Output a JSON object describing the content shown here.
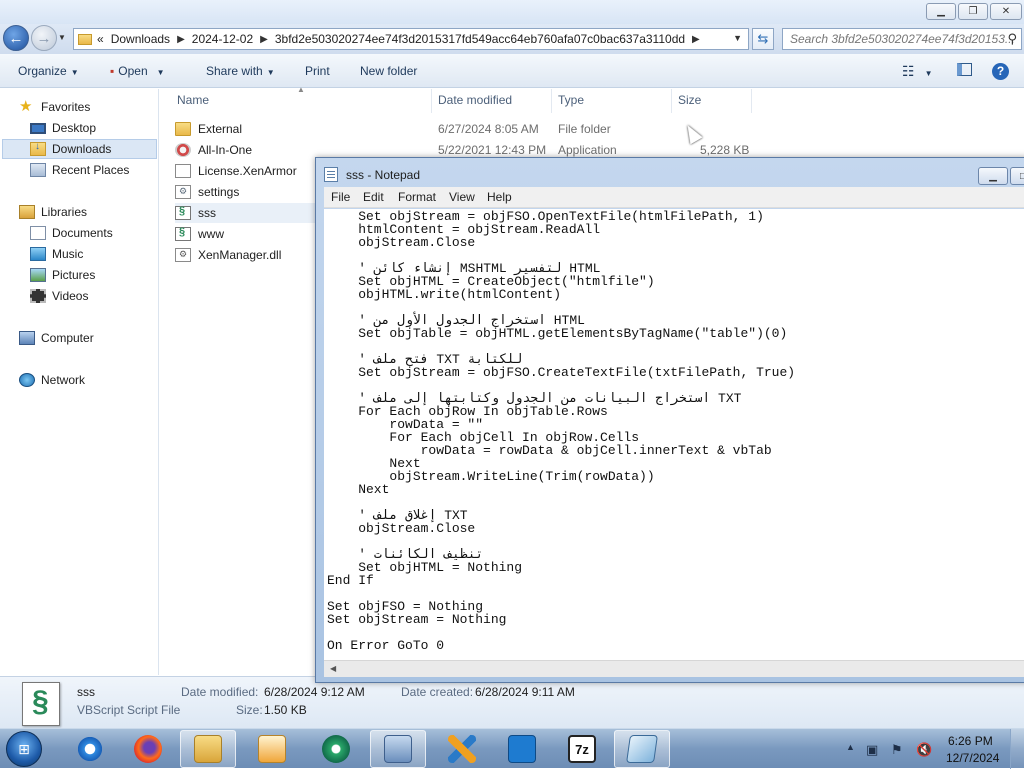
{
  "address_bar": {
    "overflow_marker": "«",
    "crumbs": [
      "Downloads",
      "2024-12-02",
      "3bfd2e503020274ee74f3d2015317fd549acc64eb760afa07c0bac637a3110dd"
    ],
    "search_placeholder": "Search 3bfd2e503020274ee74f3d20153..."
  },
  "toolbar": {
    "organize": "Organize",
    "open": "Open",
    "share_with": "Share with",
    "print": "Print",
    "new_folder": "New folder"
  },
  "nav": {
    "favorites": "Favorites",
    "desktop": "Desktop",
    "downloads": "Downloads",
    "recent_places": "Recent Places",
    "libraries": "Libraries",
    "documents": "Documents",
    "music": "Music",
    "pictures": "Pictures",
    "videos": "Videos",
    "computer": "Computer",
    "network": "Network"
  },
  "columns": {
    "name": "Name",
    "date_modified": "Date modified",
    "type": "Type",
    "size": "Size"
  },
  "files": [
    {
      "name": "External",
      "date": "6/27/2024 8:05 AM",
      "type": "File folder",
      "size": "",
      "icon": "folder-icon"
    },
    {
      "name": "All-In-One",
      "date": "5/22/2021 12:43 PM",
      "type": "Application",
      "size": "5,228 KB",
      "icon": "application-icon"
    },
    {
      "name": "License.XenArmor",
      "icon": "file-icon"
    },
    {
      "name": "settings",
      "icon": "settings-file-icon"
    },
    {
      "name": "sss",
      "icon": "vbscript-icon"
    },
    {
      "name": "www",
      "icon": "vbscript-icon"
    },
    {
      "name": "XenManager.dll",
      "icon": "dll-icon"
    }
  ],
  "details": {
    "name": "sss",
    "type": "VBScript Script File",
    "date_modified_label": "Date modified:",
    "date_modified": "6/28/2024 9:12 AM",
    "date_created_label": "Date created:",
    "date_created": "6/28/2024 9:11 AM",
    "size_label": "Size:",
    "size": "1.50 KB"
  },
  "notepad": {
    "title": "sss - Notepad",
    "menu": {
      "file": "File",
      "edit": "Edit",
      "format": "Format",
      "view": "View",
      "help": "Help"
    },
    "content": "    Set objStream = objFSO.OpenTextFile(htmlFilePath, 1)\n    htmlContent = objStream.ReadAll\n    objStream.Close\n\n    ' إنشاء كائن MSHTML لتفسير HTML\n    Set objHTML = CreateObject(\"htmlfile\")\n    objHTML.write(htmlContent)\n\n    ' استخراج الجدول الأول من HTML\n    Set objTable = objHTML.getElementsByTagName(\"table\")(0)\n\n    ' فتح ملف TXT للكتابة\n    Set objStream = objFSO.CreateTextFile(txtFilePath, True)\n\n    ' استخراج البيانات من الجدول وكتابتها إلى ملف TXT\n    For Each objRow In objTable.Rows\n        rowData = \"\"\n        For Each objCell In objRow.Cells\n            rowData = rowData & objCell.innerText & vbTab\n        Next\n        objStream.WriteLine(Trim(rowData))\n    Next\n\n    ' إغلاق ملف TXT\n    objStream.Close\n\n    ' تنظيف الكائنات\n    Set objHTML = Nothing\nEnd If\n\nSet objFSO = Nothing\nSet objStream = Nothing\n\nOn Error GoTo 0"
  },
  "clock": {
    "time": "6:26 PM",
    "date": "12/7/2024"
  }
}
